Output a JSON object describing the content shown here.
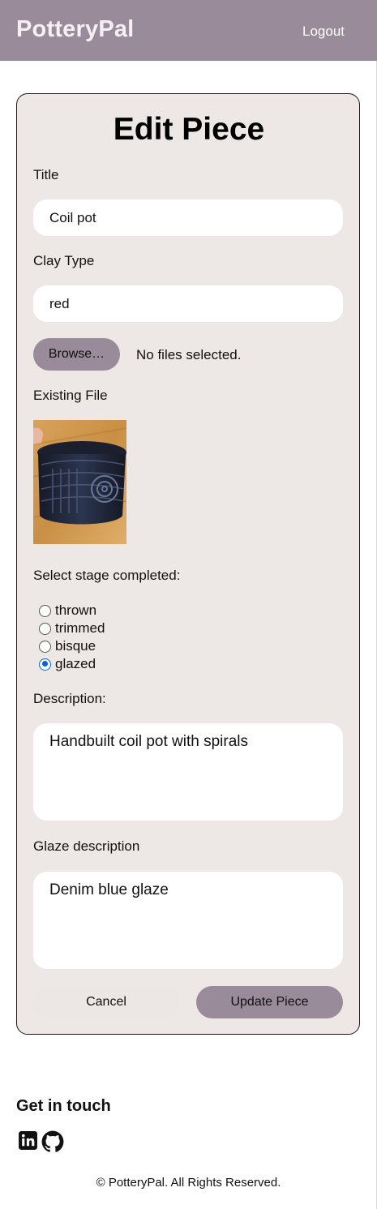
{
  "header": {
    "brand": "PotteryPal",
    "logout_label": "Logout"
  },
  "form": {
    "heading": "Edit Piece",
    "title_label": "Title",
    "title_value": "Coil pot",
    "clay_label": "Clay Type",
    "clay_value": "red",
    "browse_label": "Browse…",
    "file_status": "No files selected.",
    "existing_label": "Existing File",
    "stage_label": "Select stage completed:",
    "stages": [
      {
        "label": "thrown",
        "checked": false
      },
      {
        "label": "trimmed",
        "checked": false
      },
      {
        "label": "bisque",
        "checked": false
      },
      {
        "label": "glazed",
        "checked": true
      }
    ],
    "description_label": "Description:",
    "description_value": "Handbuilt coil pot with spirals",
    "glaze_label": "Glaze description",
    "glaze_value": "Denim blue glaze",
    "cancel_label": "Cancel",
    "update_label": "Update Piece"
  },
  "footer": {
    "get_in_touch": "Get in touch",
    "icons": [
      "linkedin-icon",
      "github-icon"
    ],
    "copyright": "© PotteryPal. All Rights Reserved."
  },
  "colors": {
    "header_bg": "#998b99",
    "card_bg": "#ede8e6",
    "accent": "#998b99",
    "radio_checked": "#0a63d6"
  }
}
